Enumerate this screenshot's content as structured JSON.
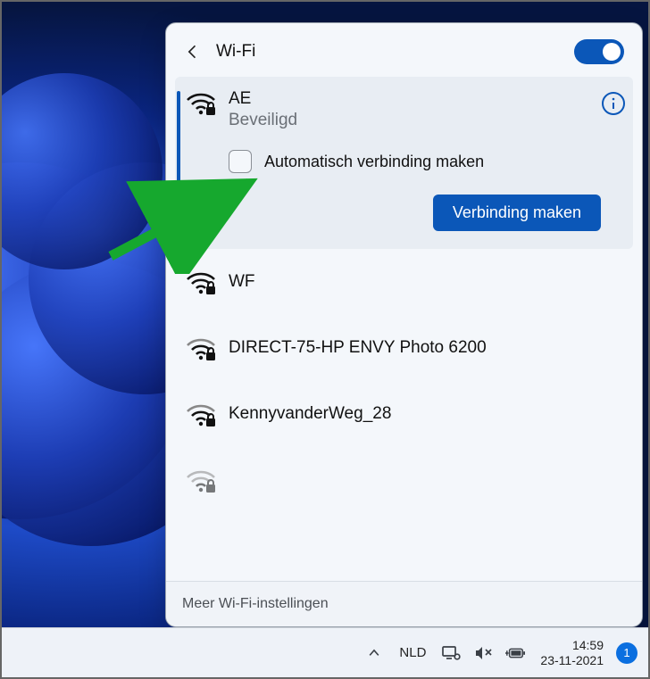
{
  "header": {
    "title": "Wi-Fi",
    "toggle_on": true
  },
  "expanded_network": {
    "name": "AE",
    "status": "Beveiligd",
    "auto_connect_label": "Automatisch verbinding maken",
    "connect_label": "Verbinding maken"
  },
  "networks": [
    {
      "name": "WF"
    },
    {
      "name": "DIRECT-75-HP ENVY Photo 6200"
    },
    {
      "name": "KennyvanderWeg_28"
    }
  ],
  "footer": {
    "more_settings": "Meer Wi-Fi-instellingen"
  },
  "taskbar": {
    "lang": "NLD",
    "time": "14:59",
    "date": "23-11-2021",
    "notif_count": "1"
  }
}
